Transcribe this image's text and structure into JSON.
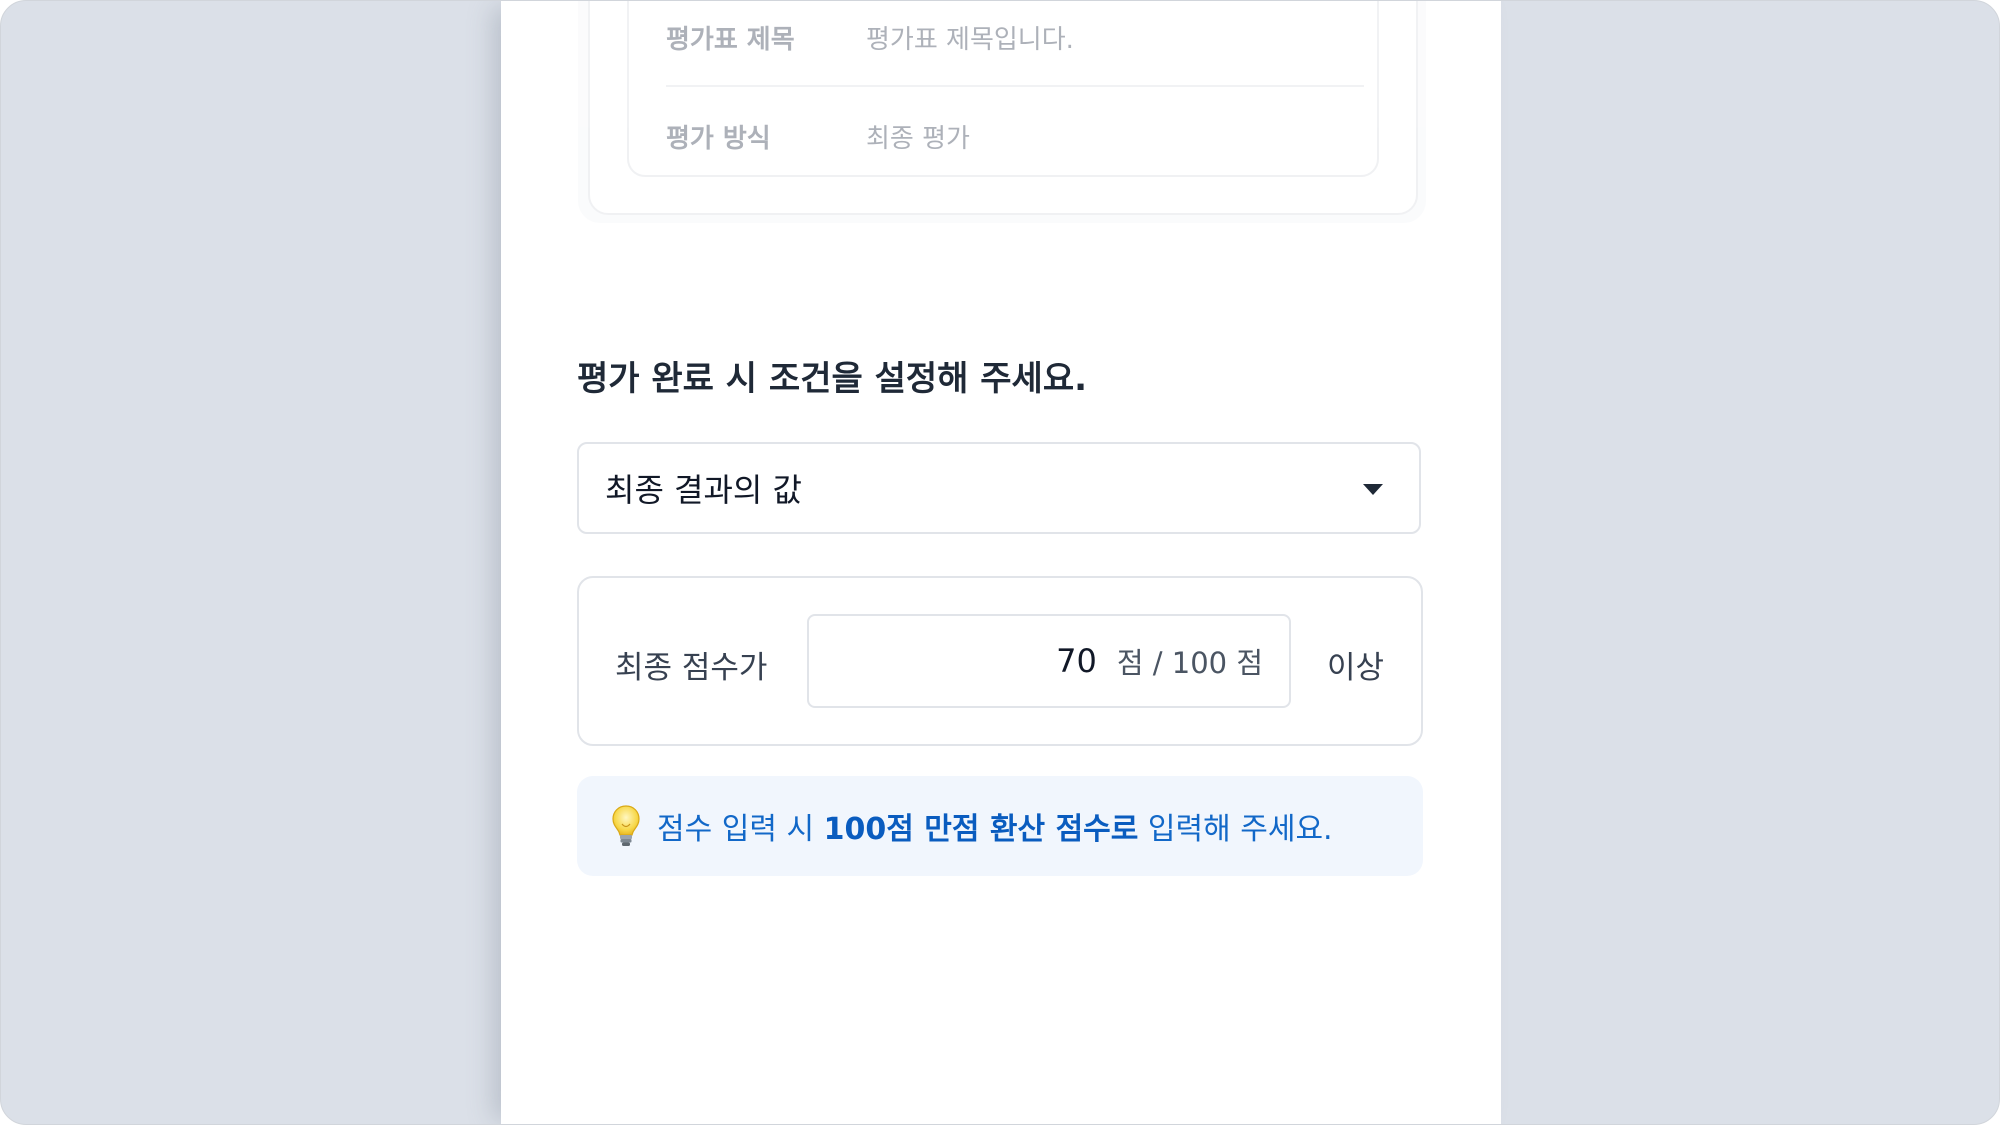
{
  "evaluation_info": {
    "title_label": "평가표 제목",
    "title_value": "평가표 제목입니다.",
    "method_label": "평가 방식",
    "method_value": "최종 평가"
  },
  "completion_condition": {
    "heading": "평가 완료 시 조건을 설정해 주세요.",
    "select": {
      "selected": "최종 결과의 값",
      "icon": "caret-down-icon"
    },
    "condition": {
      "prefix": "최종 점수가",
      "score_value": "70",
      "score_unit": "점 / 100 점",
      "suffix": "이상"
    },
    "tip": {
      "icon": "lightbulb-icon",
      "text_before": "점수 입력 시 ",
      "text_highlight": "100점 만점 환산 점수로",
      "text_after": " 입력해 주세요."
    }
  },
  "colors": {
    "background": "#dbe0e8",
    "panel": "#ffffff",
    "accent": "#1268c8",
    "tip_background": "#f1f6fd",
    "border": "#e1e4e9"
  }
}
